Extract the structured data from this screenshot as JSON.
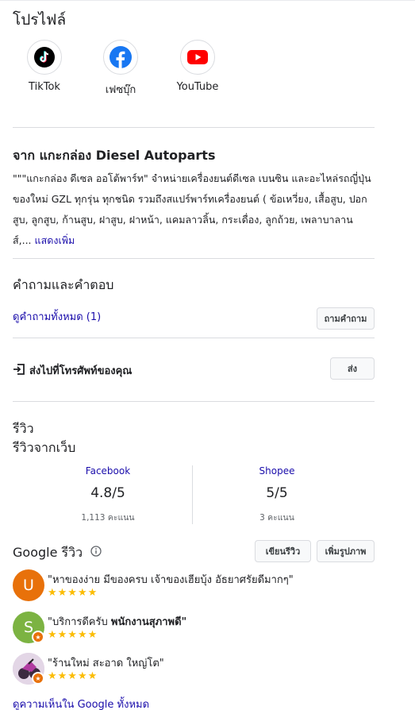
{
  "profiles": {
    "title": "โปรไฟล์",
    "items": [
      {
        "label": "TikTok",
        "icon": "tiktok-icon"
      },
      {
        "label": "เฟซบุ๊ก",
        "icon": "facebook-icon"
      },
      {
        "label": "YouTube",
        "icon": "youtube-icon"
      }
    ]
  },
  "about": {
    "title": "จาก แกะกล่อง Diesel Autoparts",
    "description": "\"\"\"แกะกล่อง ดีเซล ออโต้พาร์ท\" จำหน่ายเครื่องยนต์ดีเซล เบนซิน และอะไหล่รถญี่ปุ่น ของใหม่ GZL ทุกรุ่น ทุกชนิด รวมถึงสแปร์พาร์ทเครื่องยนต์ ( ข้อเหวี่ยง, เสื้อสูบ, ปอกสูบ, ลูกสูบ, ก้านสูบ, ฝาสูบ, ฝาหน้า, แคมลาวลิ้น, กระเดื่อง, ลูกถ้วย, เพลาบาลานส์,...",
    "more_label": "แสดงเพิ่ม"
  },
  "qa": {
    "title": "คำถามและคำตอบ",
    "all_link": "ดูคำถามทั้งหมด (1)",
    "ask_button": "ถามคำถาม"
  },
  "send": {
    "label": "ส่งไปที่โทรศัพท์ของคุณ",
    "button": "ส่ง"
  },
  "reviews": {
    "title": "รีวิว",
    "web_title": "รีวิวจากเว็บ",
    "web_sources": [
      {
        "name": "Facebook",
        "score": "4.8/5",
        "count": "1,113 คะแนน"
      },
      {
        "name": "Shopee",
        "score": "5/5",
        "count": "3 คะแนน"
      }
    ],
    "google_title": "Google รีวิว",
    "write_button": "เขียนรีวิว",
    "add_photo_button": "เพิ่มรูปภาพ",
    "stars": "★★★★★",
    "items": [
      {
        "initial": "U",
        "avatar_color": "#e8710a",
        "text_plain": "\"หาของง่าย มีของครบ เจ้าของเฮียบุ้ง อัธยาศรัยดีมากๆ\"",
        "text_bold": ""
      },
      {
        "initial": "S",
        "avatar_color": "#7cb342",
        "text_plain": "\"บริการดีครับ ",
        "text_bold": "พนักงานสุภาพดี\""
      },
      {
        "initial": "",
        "avatar_color": "#6a4a7a",
        "text_plain": "\"ร้านใหม่ สะอาด ใหญ่โต\"",
        "text_bold": ""
      }
    ],
    "all_link": "ดูความเห็นใน Google ทั้งหมด"
  }
}
